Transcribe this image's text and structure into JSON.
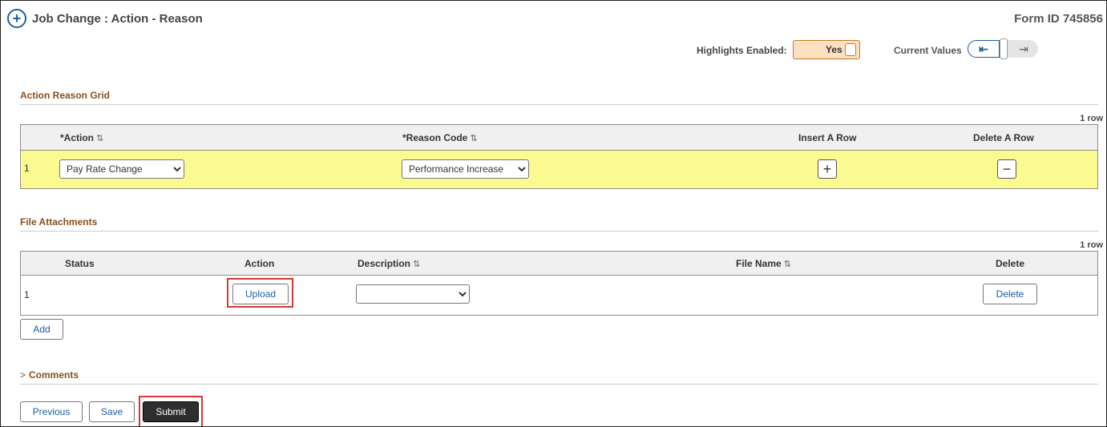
{
  "header": {
    "title": "Job Change : Action - Reason",
    "form_id_label": "Form ID",
    "form_id_value": "745856",
    "highlights_label": "Highlights Enabled:",
    "highlights_value": "Yes",
    "current_values_label": "Current Values",
    "cv_left_glyph": "⇤",
    "cv_right_glyph": "⇥"
  },
  "action_reason_grid": {
    "title": "Action Reason Grid",
    "row_count": "1 row",
    "columns": {
      "action": "*Action",
      "reason_code": "*Reason Code",
      "insert": "Insert A Row",
      "delete": "Delete A Row"
    },
    "rows": [
      {
        "num": "1",
        "action": "Pay Rate Change",
        "reason_code": "Performance Increase"
      }
    ],
    "row_highlight_color": "#fafa90"
  },
  "file_attachments": {
    "title": "File Attachments",
    "row_count": "1 row",
    "columns": {
      "status": "Status",
      "action": "Action",
      "description": "Description",
      "file_name": "File Name",
      "delete": "Delete"
    },
    "rows": [
      {
        "num": "1",
        "upload_label": "Upload",
        "description": "",
        "delete_label": "Delete"
      }
    ],
    "add_label": "Add"
  },
  "comments": {
    "label": "Comments",
    "chevron": ">"
  },
  "footer": {
    "previous": "Previous",
    "save": "Save",
    "submit": "Submit"
  },
  "colors": {
    "accent_blue": "#1f5fa3",
    "section_brown": "#8b4f1d",
    "highlight_red": "#d93636",
    "toggle_orange": "#fbe0c2"
  }
}
